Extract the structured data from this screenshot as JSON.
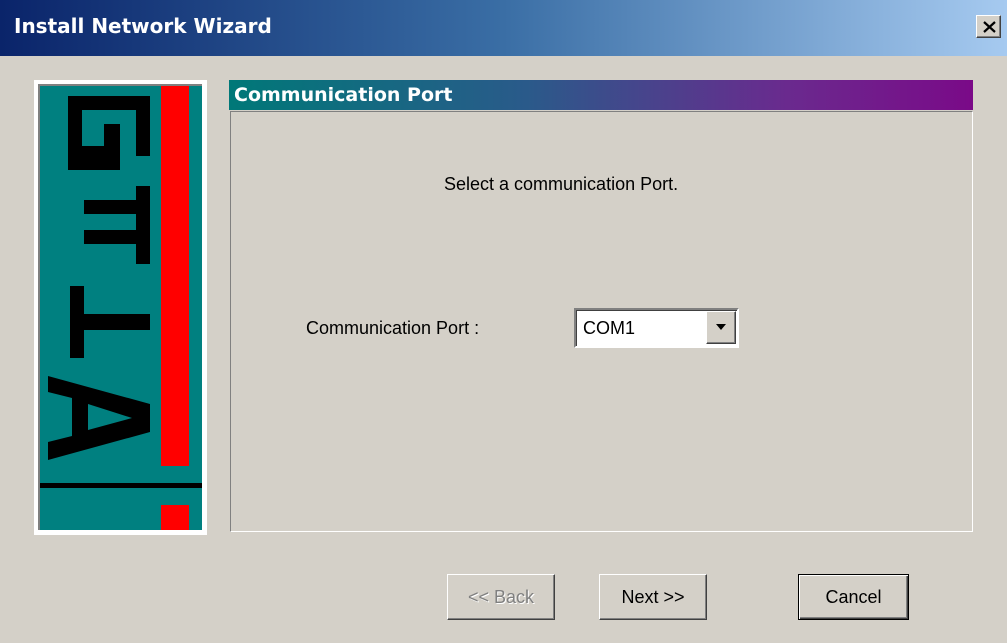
{
  "window": {
    "title": "Install Network Wizard",
    "close_icon": "close-x-icon"
  },
  "logo": {
    "text": "ATEQ",
    "icon": "ateq-logo",
    "colors": {
      "background": "#008080",
      "bar": "#ff0000",
      "letters": "#000000"
    }
  },
  "section": {
    "title": "Communication Port"
  },
  "content": {
    "instruction": "Select a communication Port.",
    "port_label": "Communication Port :",
    "port_value": "COM1",
    "dropdown_icon": "chevron-down-icon"
  },
  "buttons": {
    "back": "<< Back",
    "next": "Next >>",
    "cancel": "Cancel",
    "back_enabled": false
  }
}
